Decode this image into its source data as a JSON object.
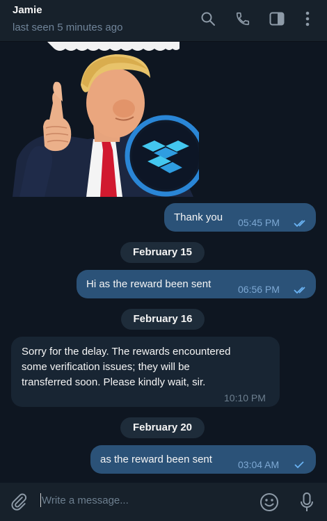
{
  "header": {
    "contact_name": "Jamie",
    "status": "last seen 5 minutes ago",
    "icons": [
      "search-icon",
      "phone-icon",
      "sidebar-toggle-icon",
      "more-vertical-icon"
    ]
  },
  "messages": [
    {
      "direction": "out",
      "text": "Thank you",
      "time": "05:45 PM",
      "read": true
    },
    {
      "type": "date",
      "text": "February 15"
    },
    {
      "direction": "out",
      "text": "Hi as the reward been sent",
      "time": "06:56 PM",
      "read": true
    },
    {
      "type": "date",
      "text": "February 16"
    },
    {
      "direction": "in",
      "lines": [
        "Sorry for the delay. The rewards encountered",
        "some verification issues; they will be",
        "transferred soon. Please kindly wait, sir."
      ],
      "time": "10:10 PM"
    },
    {
      "type": "date",
      "text": "February 20"
    },
    {
      "direction": "out",
      "text": "as the reward been sent",
      "time": "03:04 AM",
      "read": false
    }
  ],
  "composer": {
    "placeholder": "Write a message...",
    "icons": [
      "attach-icon",
      "emoji-icon",
      "microphone-icon"
    ]
  },
  "colors": {
    "background": "#0e1621",
    "header": "#17212b",
    "outgoing_bubble": "#2b5278",
    "incoming_bubble": "#182533",
    "accent": "#6ab3f3"
  }
}
